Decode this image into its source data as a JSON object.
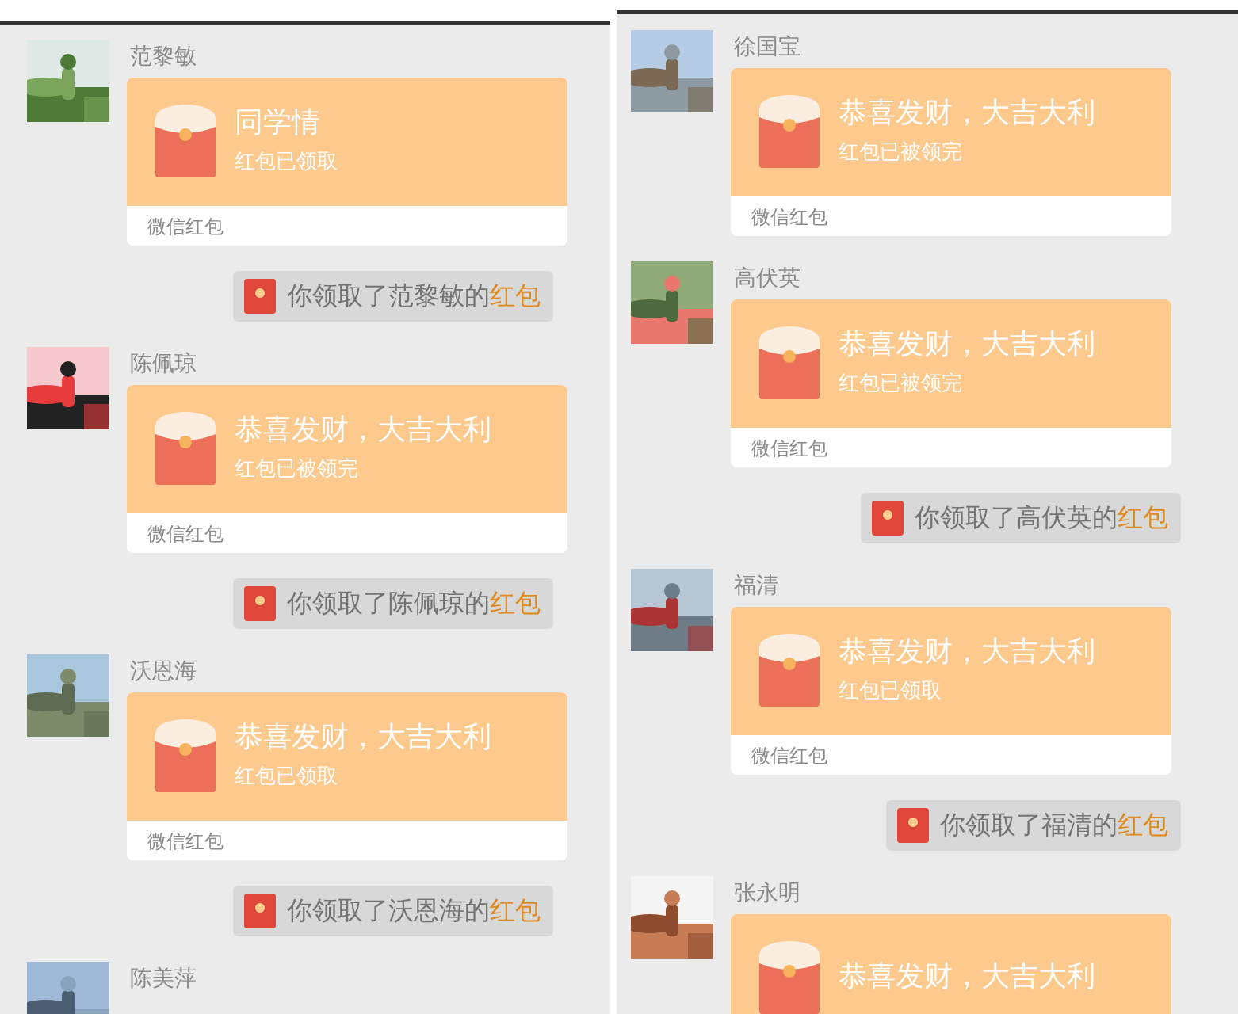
{
  "panels": [
    {
      "items": [
        {
          "kind": "message",
          "sender": "范黎敏",
          "title": "同学情",
          "status": "红包已领取",
          "footer": "微信红包"
        },
        {
          "kind": "notice",
          "text": "你领取了范黎敏的",
          "link": "红包"
        },
        {
          "kind": "message",
          "sender": "陈佩琼",
          "title": "恭喜发财，大吉大利",
          "status": "红包已被领完",
          "footer": "微信红包"
        },
        {
          "kind": "notice",
          "text": "你领取了陈佩琼的",
          "link": "红包"
        },
        {
          "kind": "message",
          "sender": "沃恩海",
          "title": "恭喜发财，大吉大利",
          "status": "红包已领取",
          "footer": "微信红包"
        },
        {
          "kind": "notice",
          "text": "你领取了沃恩海的",
          "link": "红包"
        },
        {
          "kind": "message",
          "sender": "陈美萍"
        }
      ]
    },
    {
      "items": [
        {
          "kind": "message",
          "sender": "徐国宝",
          "title": "恭喜发财，大吉大利",
          "status": "红包已被领完",
          "footer": "微信红包"
        },
        {
          "kind": "message",
          "sender": "高伏英",
          "title": "恭喜发财，大吉大利",
          "status": "红包已被领完",
          "footer": "微信红包"
        },
        {
          "kind": "notice",
          "text": "你领取了高伏英的",
          "link": "红包"
        },
        {
          "kind": "message",
          "sender": "福清",
          "title": "恭喜发财，大吉大利",
          "status": "红包已领取",
          "footer": "微信红包"
        },
        {
          "kind": "notice",
          "text": "你领取了福清的",
          "link": "红包"
        },
        {
          "kind": "message",
          "sender": "张永明",
          "title": "恭喜发财，大吉大利"
        }
      ]
    }
  ]
}
